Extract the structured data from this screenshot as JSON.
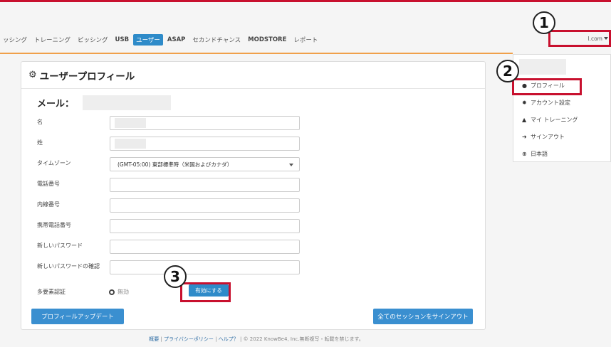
{
  "nav": {
    "items": [
      {
        "label": "ッシング",
        "bold": false,
        "active": false
      },
      {
        "label": "トレーニング",
        "bold": false,
        "active": false
      },
      {
        "label": "ビッシング",
        "bold": false,
        "active": false
      },
      {
        "label": "USB",
        "bold": true,
        "active": false
      },
      {
        "label": "ユーザー",
        "bold": false,
        "active": true
      },
      {
        "label": "ASAP",
        "bold": true,
        "active": false
      },
      {
        "label": "セカンドチャンス",
        "bold": false,
        "active": false
      },
      {
        "label": "MODSTORE",
        "bold": true,
        "active": false
      },
      {
        "label": "レポート",
        "bold": false,
        "active": false
      }
    ]
  },
  "user_menu": {
    "label": "l.com"
  },
  "profile": {
    "title": "ユーザープロフィール",
    "email_label": "メール：",
    "fields": {
      "first_name": "名",
      "last_name": "姓",
      "timezone": "タイムゾーン",
      "phone": "電話番号",
      "extension": "内線番号",
      "mobile": "携帯電話番号",
      "new_password": "新しいパスワード",
      "confirm_password": "新しいパスワードの確認",
      "mfa": "多要素認証"
    },
    "timezone_value": "(GMT-05:00) 東部標準時（米国およびカナダ）",
    "mfa_status": "無効",
    "enable_button": "有効にする",
    "update_button": "プロフィールアップデート",
    "signout_all_button": "全てのセッションをサインアウト"
  },
  "dropdown": {
    "items": [
      {
        "label": "プロフィール",
        "icon": "user-icon"
      },
      {
        "label": "アカウント設定",
        "icon": "gear-icon"
      },
      {
        "label": "マイ トレーニング",
        "icon": "graduation-cap-icon"
      },
      {
        "label": "サインアウト",
        "icon": "sign-out-icon"
      },
      {
        "label": "日本語",
        "icon": "globe-icon"
      }
    ]
  },
  "footer": {
    "overview": "概要",
    "privacy": "プライバシーポリシー",
    "help": "ヘルプ？",
    "sep": "|",
    "copyright": "© 2022 KnowBe4, Inc.無断複写・転載を禁じます。"
  },
  "callouts": {
    "one": "1",
    "two": "2",
    "three": "3"
  },
  "colors": {
    "accent": "#2e8bc9",
    "callout": "#c8102e",
    "orange": "#f0a04a"
  }
}
